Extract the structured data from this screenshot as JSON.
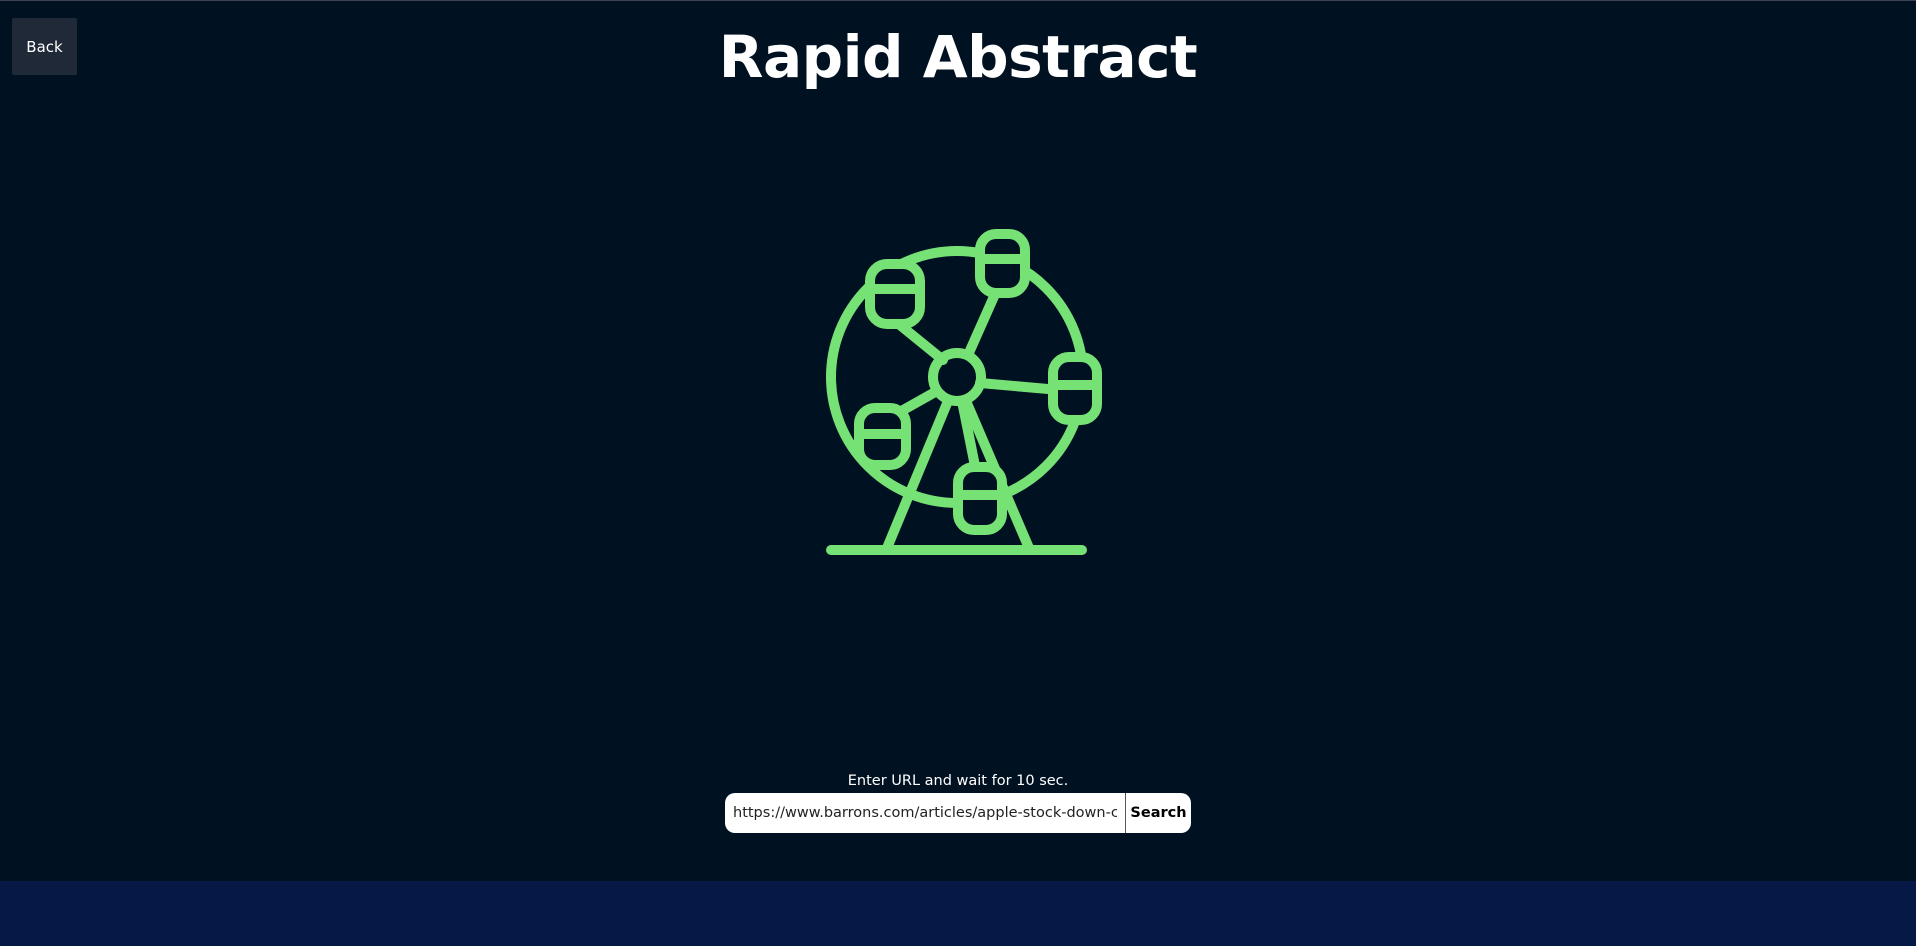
{
  "header": {
    "back_label": "Back",
    "title": "Rapid Abstract"
  },
  "hero": {
    "icon": "ferris-wheel-icon",
    "icon_color": "#76e276"
  },
  "search": {
    "hint": "Enter URL and wait for 10 sec.",
    "input_value": "https://www.barrons.com/articles/apple-stock-down-c",
    "button_label": "Search"
  },
  "colors": {
    "background": "#001122",
    "footer": "#061946",
    "back_button": "#1f2937",
    "accent": "#76e276"
  }
}
